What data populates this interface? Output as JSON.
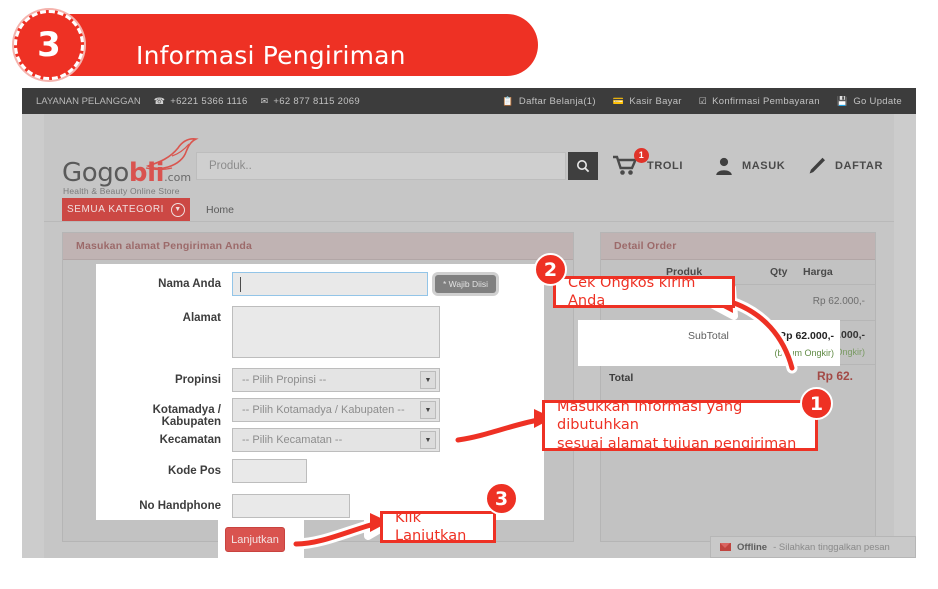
{
  "banner": {
    "step_number": "3",
    "title": "Informasi Pengiriman",
    "color": "#ee3124"
  },
  "topbar": {
    "customer_service_label": "LAYANAN PELANGGAN",
    "phone_icon": "phone-icon",
    "phone": "+6221 5366 1116",
    "whatsapp_icon": "whatsapp-icon",
    "whatsapp": "+62 877 8115 2069",
    "links": [
      {
        "icon": "list-icon",
        "label": "Daftar Belanja(1)"
      },
      {
        "icon": "cashier-icon",
        "label": "Kasir Bayar"
      },
      {
        "icon": "check-icon",
        "label": "Konfirmasi Pembayaran"
      },
      {
        "icon": "save-icon",
        "label": "Go Update"
      }
    ]
  },
  "header": {
    "logo_main": "Gogo",
    "logo_accent": "bli",
    "logo_com": ".com",
    "logo_tagline": "Health & Beauty Online Store",
    "search_placeholder": "Produk..",
    "search_value": "",
    "search_button_icon": "search-icon",
    "cart_label": "TROLI",
    "cart_count": "1",
    "login_label": "MASUK",
    "register_label": "DAFTAR"
  },
  "nav": {
    "kategori_label": "SEMUA KATEGORI",
    "kategori_chevron": "chevron-down-icon",
    "breadcrumb_home": "Home"
  },
  "form_panel": {
    "title": "Masukan alamat Pengiriman Anda",
    "fields": [
      {
        "label": "Nama Anda",
        "type": "text",
        "value": "",
        "focused": true
      },
      {
        "label": "Alamat",
        "type": "textarea",
        "value": ""
      },
      {
        "label": "Propinsi",
        "type": "select",
        "value": "-- Pilih Propinsi --"
      },
      {
        "label": "Kotamadya / Kabupaten",
        "type": "select",
        "value": "-- Pilih Kotamadya / Kabupaten --"
      },
      {
        "label": "Kecamatan",
        "type": "select",
        "value": "-- Pilih Kecamatan --"
      },
      {
        "label": "Kode Pos",
        "type": "text",
        "value": ""
      },
      {
        "label": "No Handphone",
        "type": "text",
        "value": ""
      }
    ],
    "required_tooltip": "* Wajib Diisi",
    "submit_label": "Lanjutkan"
  },
  "order_panel": {
    "title": "Detail Order",
    "columns": [
      "Produk",
      "Qty",
      "Harga"
    ],
    "rows": [
      {
        "produk": "",
        "qty": "",
        "harga": "Rp 62.000,-"
      }
    ],
    "subtotal_label": "SubTotal",
    "subtotal_value": "Rp 62.000,-",
    "subtotal_note": "(belum Ongkir)",
    "total_label": "Total",
    "total_value": "Rp 62."
  },
  "chat_widget": {
    "icon": "envelope-icon",
    "status": "Offline",
    "message": "- Silahkan tinggalkan pesan"
  },
  "annotations": [
    {
      "badge": "1",
      "text": "Masukkan informasi yang dibutuhkan\nsesuai alamat tujuan pengiriman"
    },
    {
      "badge": "2",
      "text": "Cek Ongkos kirim Anda"
    },
    {
      "badge": "3",
      "text": "Klik Lanjutkan"
    }
  ],
  "annotation_text": {
    "one_line1": "Masukkan informasi yang dibutuhkan",
    "one_line2": "sesuai alamat tujuan pengiriman",
    "two": "Cek Ongkos kirim Anda",
    "three": "Klik Lanjutkan",
    "badge1": "1",
    "badge2": "2",
    "badge3": "3"
  }
}
